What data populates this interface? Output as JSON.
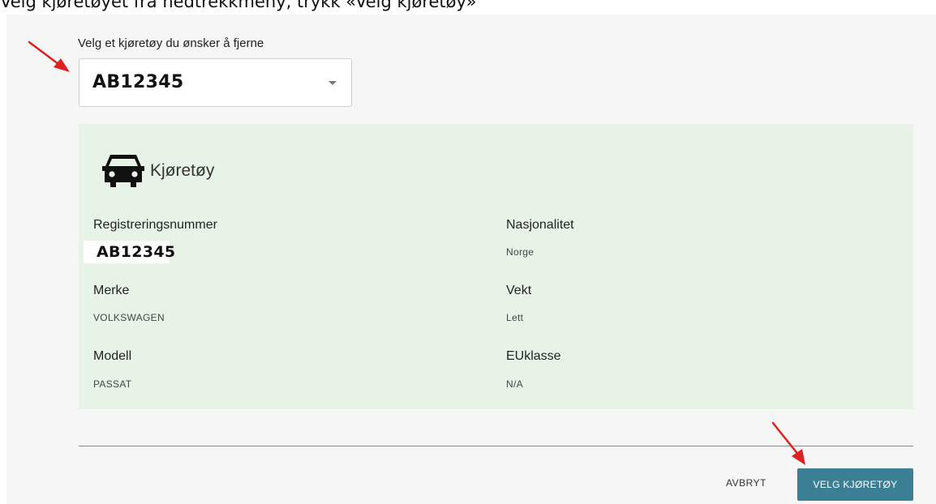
{
  "instruction": "Velg kjøretøyet fra nedtrekkmeny, trykk «Velg kjøretøy»",
  "select": {
    "label": "Velg et kjøretøy du ønsker å fjerne",
    "value": "AB12345"
  },
  "vehicle_card": {
    "title": "Kjøretøy",
    "fields": {
      "registration": {
        "label": "Registreringsnummer",
        "value": "AB12345"
      },
      "nationality": {
        "label": "Nasjonalitet",
        "value": "Norge"
      },
      "make": {
        "label": "Merke",
        "value": "VOLKSWAGEN"
      },
      "weight": {
        "label": "Vekt",
        "value": "Lett"
      },
      "model": {
        "label": "Modell",
        "value": "PASSAT"
      },
      "eu_class": {
        "label": "EUklasse",
        "value": "N/A"
      }
    }
  },
  "actions": {
    "cancel_label": "AVBRYT",
    "confirm_label": "VELG KJØRETØY"
  },
  "colors": {
    "card_background": "#e8f3e7",
    "primary_button": "#3a7f93",
    "annotation_arrow": "#e02020"
  }
}
